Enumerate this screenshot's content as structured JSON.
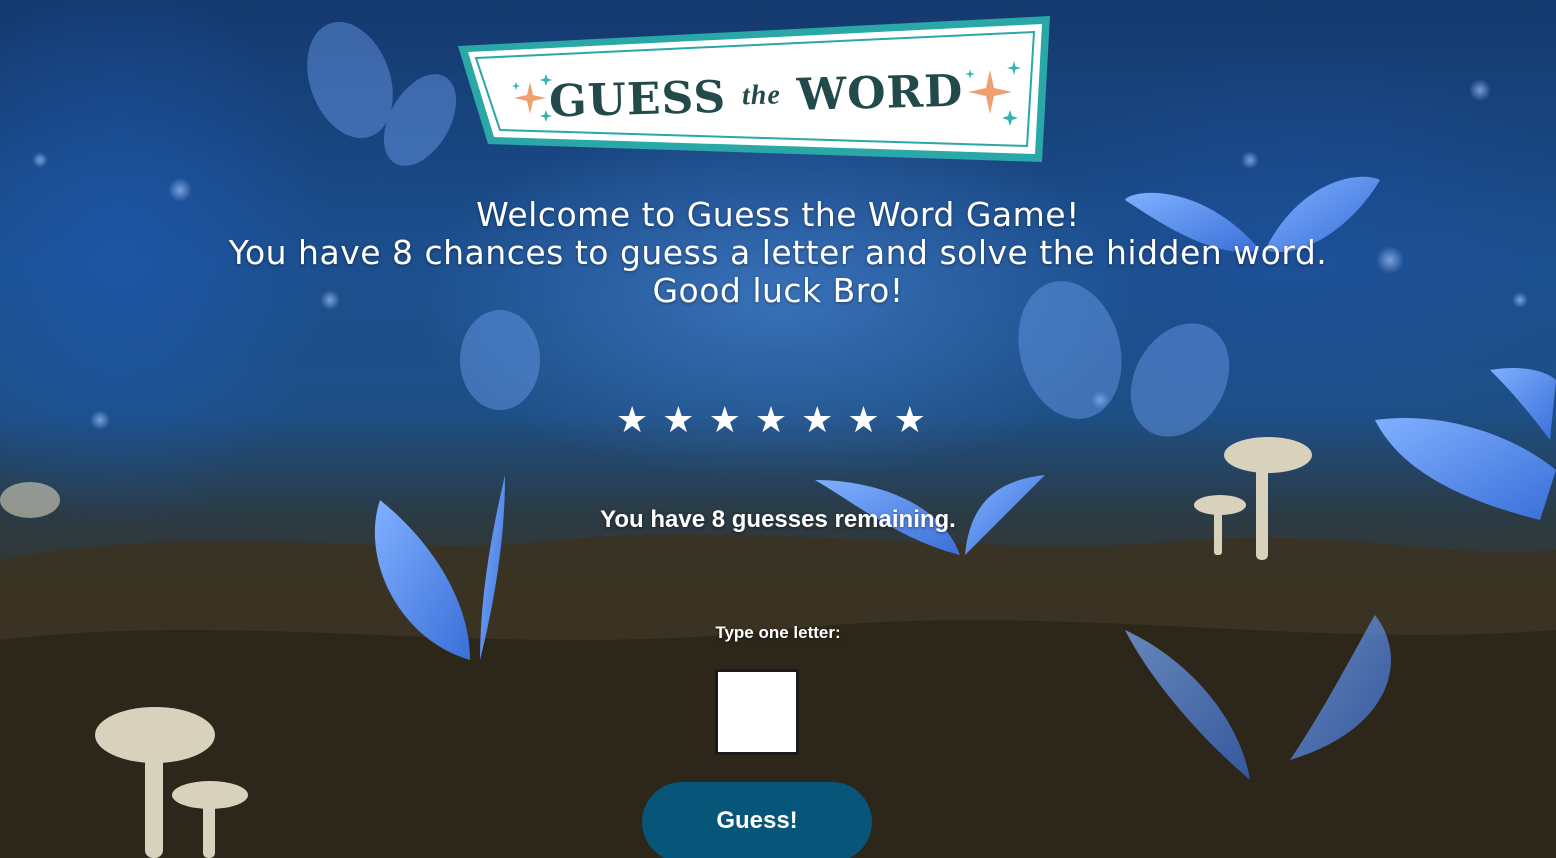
{
  "logo": {
    "guess": "GUESS",
    "the": "the",
    "word": "WORD"
  },
  "welcome": {
    "line1": "Welcome to Guess the Word Game!",
    "line2": "You have 8 chances to guess a letter and solve the hidden word.",
    "line3": "Good luck Bro!"
  },
  "word_progress": "★★★★★★★",
  "remaining_text": "You have 8 guesses remaining.",
  "input": {
    "label": "Type one letter:",
    "value": ""
  },
  "guess_button": {
    "label": "Guess!"
  },
  "colors": {
    "button": "#08557a",
    "logo_border": "#2aa7a7",
    "logo_text": "#234a4a",
    "sparkle_orange": "#f0a070",
    "sparkle_teal": "#2fb3b3"
  }
}
